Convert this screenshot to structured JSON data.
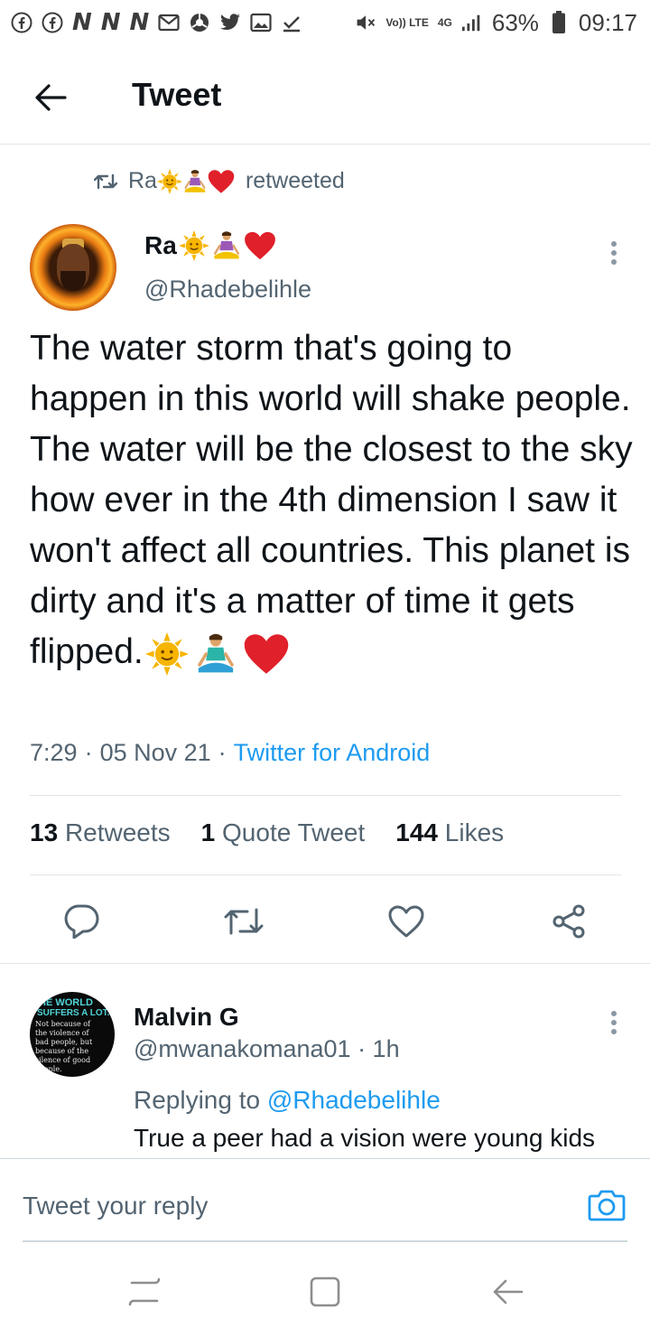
{
  "status_bar": {
    "battery": "63%",
    "time": "09:17",
    "network": "4G",
    "volte": "Vo)) LTE",
    "icons": [
      "facebook-icon",
      "facebook-icon",
      "n-app-icon",
      "n-app-icon",
      "n-app-icon",
      "mail-icon",
      "browser-icon",
      "twitter-icon",
      "gallery-icon",
      "download-done-icon",
      "mute-icon",
      "signal-icon",
      "battery-icon"
    ]
  },
  "header": {
    "title": "Tweet"
  },
  "retweet_context": {
    "name": "Ra",
    "suffix": "retweeted"
  },
  "tweet": {
    "author_name": "Ra",
    "author_handle": "@Rhadebelihle",
    "text": "The water storm that's going to happen in this world will shake people. The water will be the closest to the sky how ever in the 4th dimension I saw it won't affect all countries. This planet is dirty and it's a matter of time it gets flipped.",
    "time": "7:29",
    "separator": "·",
    "date": "05 Nov 21",
    "source": "Twitter for Android",
    "stats": {
      "retweets_count": "13",
      "retweets_label": "Retweets",
      "quotes_count": "1",
      "quotes_label": "Quote Tweet",
      "likes_count": "144",
      "likes_label": "Likes"
    }
  },
  "reply": {
    "avatar_text": {
      "line1": "HE WORLD",
      "line2": "SUFFERS A LOT.",
      "line3": "Not because of the violence of bad people, but because of the silence of good people."
    },
    "author_name": "Malvin G",
    "author_handle": "@mwanakomana01",
    "age": "· 1h",
    "replying_prefix": "Replying to",
    "replying_mention": "@Rhadebelihle",
    "text": "True a peer had a vision were young kids"
  },
  "composer": {
    "placeholder": "Tweet your reply"
  },
  "colors": {
    "link": "#1d9bf0",
    "secondary_text": "#536471",
    "heart": "#e0202a",
    "sun": "#f6b500"
  }
}
